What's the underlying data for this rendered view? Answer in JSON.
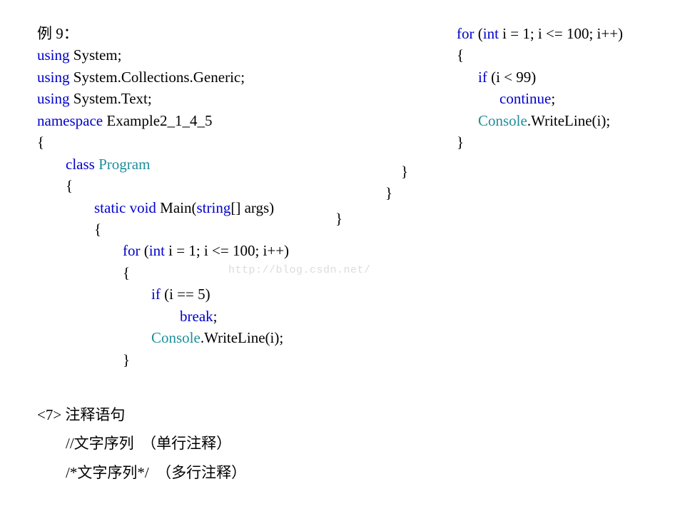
{
  "left": {
    "title": "例 9：",
    "l1a": "using",
    "l1b": " System;",
    "l2a": "using",
    "l2b": " System.Collections.Generic;",
    "l3a": "using",
    "l3b": " System.Text;",
    "l4a": "namespace",
    "l4b": " Example2_1_4_5",
    "l5": "{",
    "l6a": "class ",
    "l6b": "Program",
    "l7": "{",
    "l8a": "static",
    "l8b": " ",
    "l8c": "void",
    "l8d": " Main(",
    "l8e": "string",
    "l8f": "[] args)",
    "l9": "{",
    "l10a": "for",
    "l10b": " (",
    "l10c": "int",
    "l10d": " i = 1; i <= 100; i++)",
    "l11": "{",
    "l12a": "if",
    "l12b": " (i == 5)",
    "l13a": "break",
    "l13b": ";",
    "l14a": "Console",
    "l14b": ".WriteLine(i);",
    "l15": "}"
  },
  "right": {
    "r1a": "for",
    "r1b": " (",
    "r1c": "int",
    "r1d": " i = 1; i <= 100; i++)",
    "r2": "{",
    "r3a": "if",
    "r3b": " (i < 99)",
    "r4a": "continue",
    "r4b": ";",
    "r5a": "Console",
    "r5b": ".WriteLine(i);",
    "r6": "}",
    "r7": "}",
    "r8": "}",
    "r9": "}"
  },
  "bottom": {
    "h": "<7> 注释语句",
    "b1": "//文字序列  （单行注释）",
    "b2": "/*文字序列*/  （多行注释）"
  },
  "watermark": "http://blog.csdn.net/"
}
